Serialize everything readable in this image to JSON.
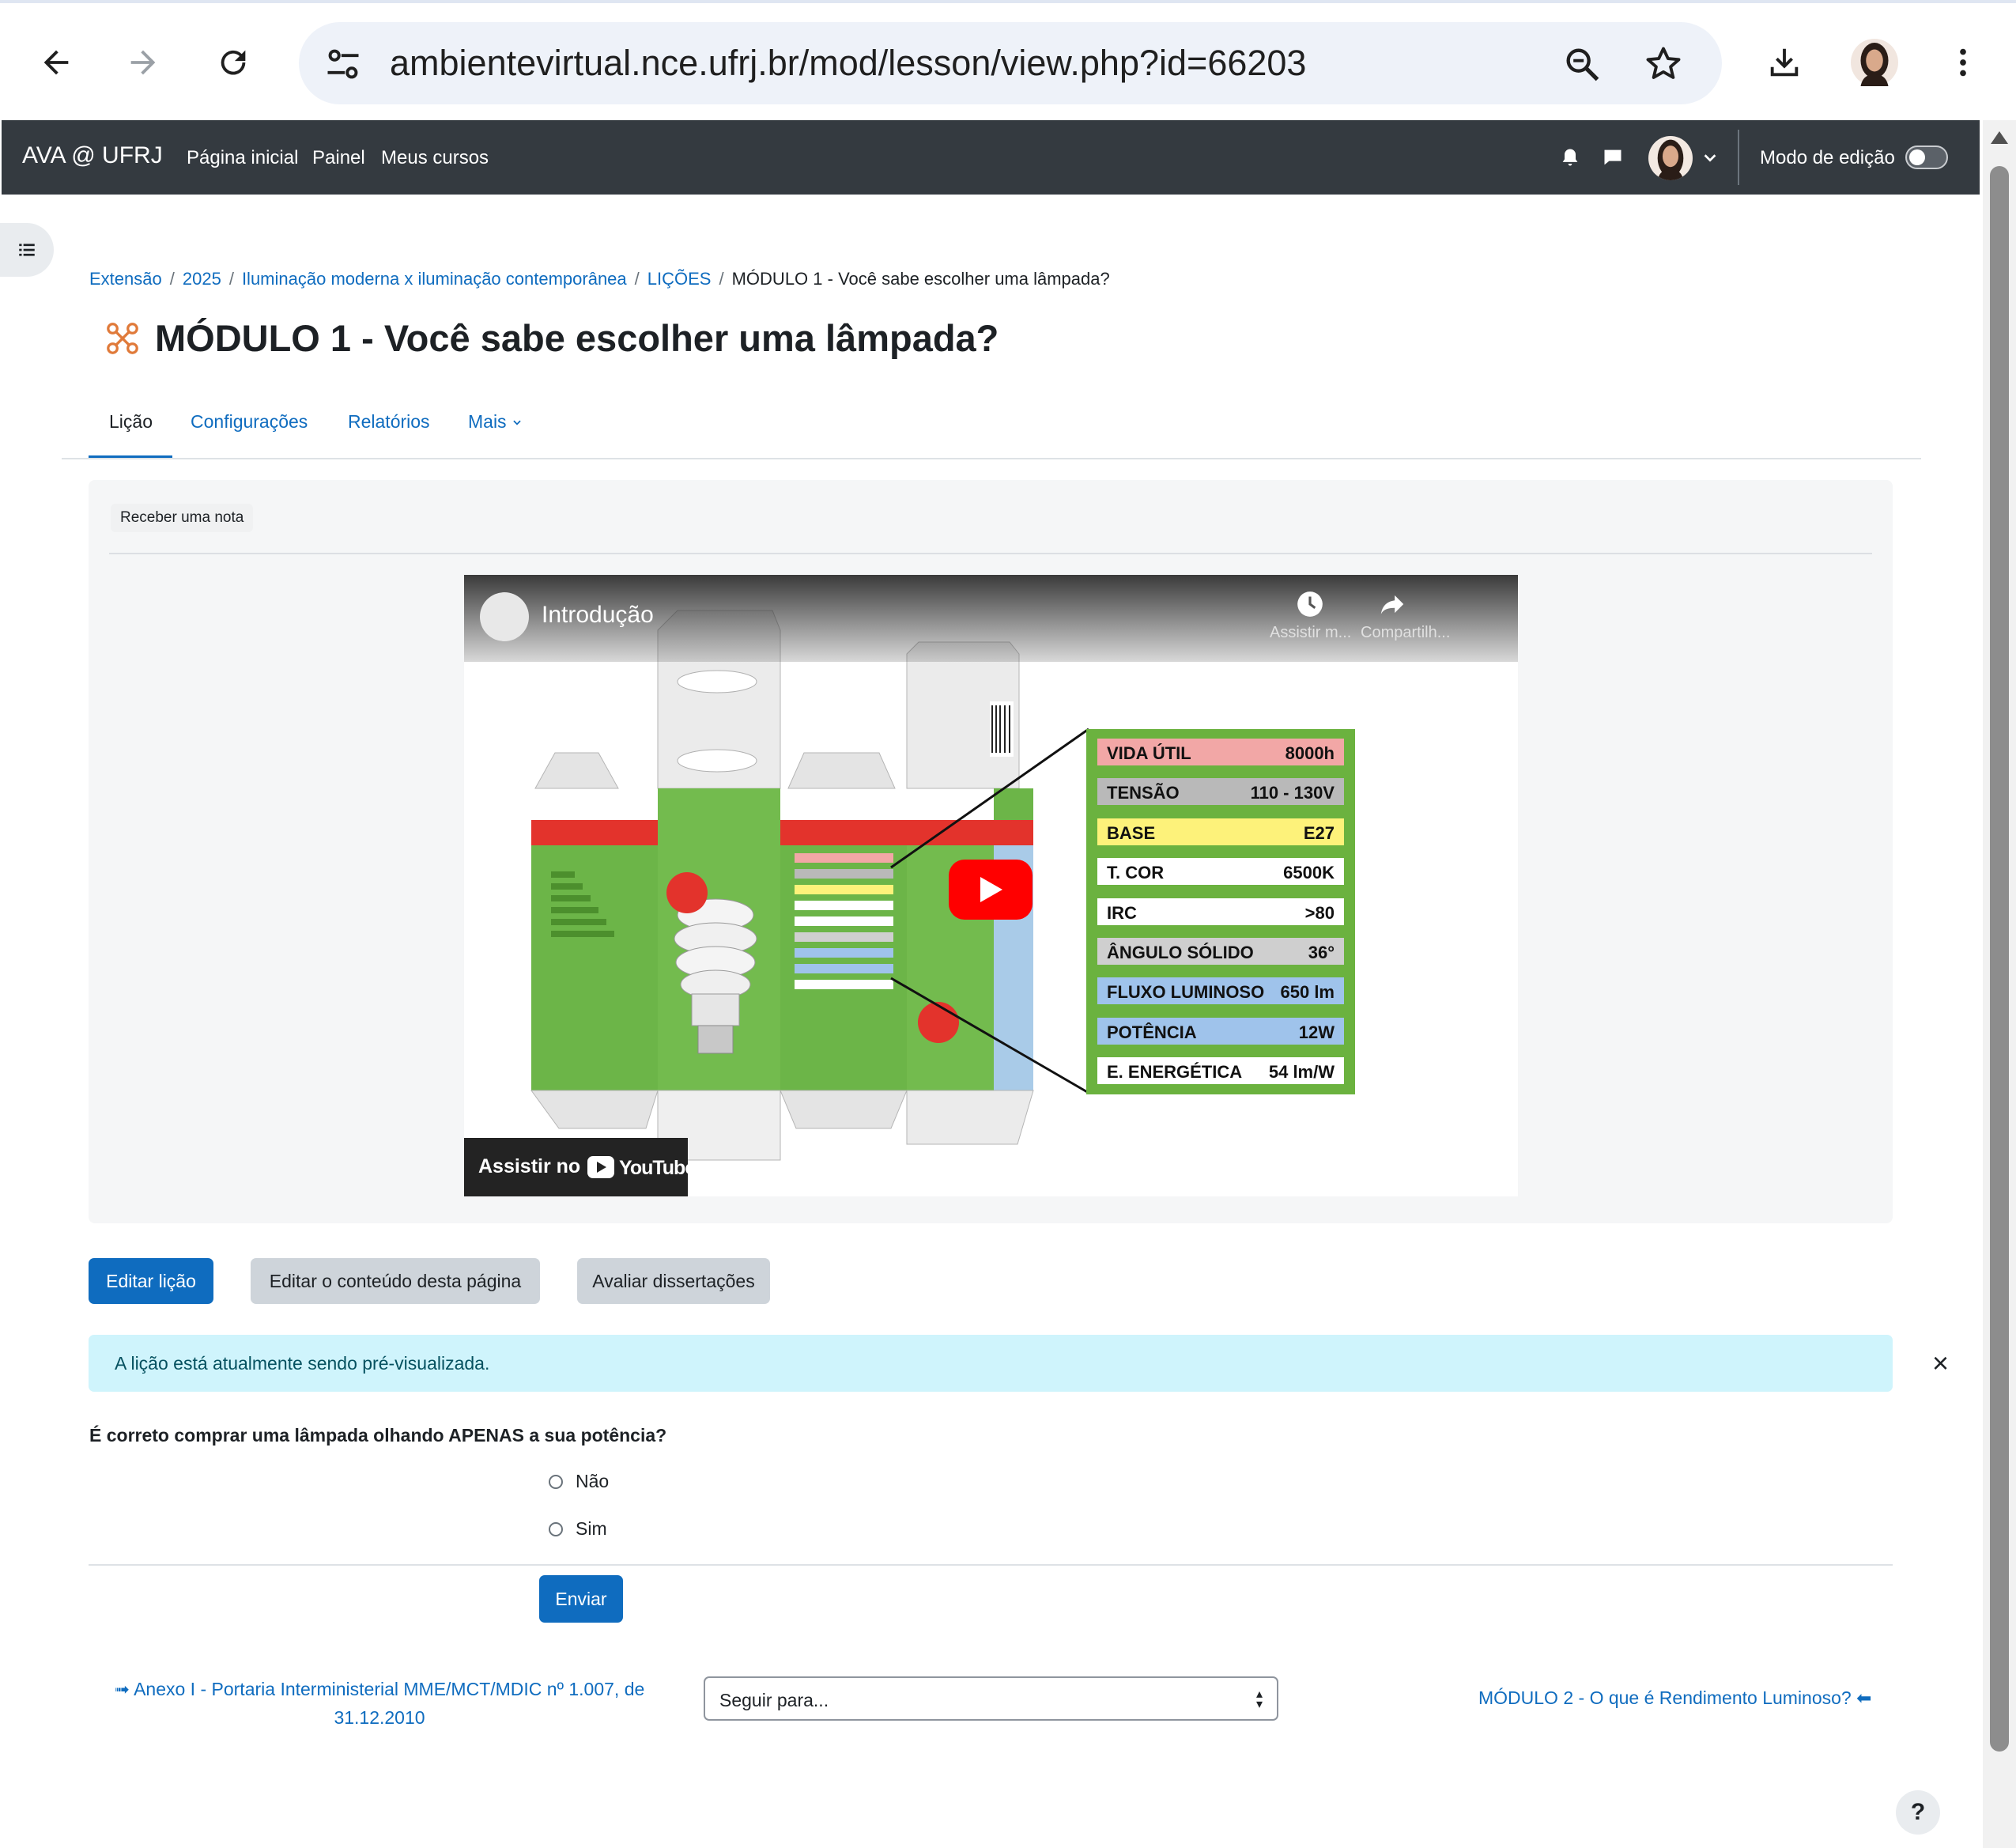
{
  "browser": {
    "url": "ambientevirtual.nce.ufrj.br/mod/lesson/view.php?id=66203",
    "icons": [
      "back-arrow-icon",
      "forward-arrow-icon",
      "reload-icon",
      "site-settings-icon",
      "zoom-icon",
      "bookmark-star-icon",
      "download-icon",
      "profile-avatar",
      "kebab-menu-icon"
    ]
  },
  "navbar": {
    "brand": "AVA @ UFRJ",
    "links": [
      "Página inicial",
      "Painel",
      "Meus cursos"
    ],
    "edit_mode_label": "Modo de edição"
  },
  "breadcrumb": {
    "items": [
      "Extensão",
      "2025",
      "Iluminação moderna x iluminação contemporânea",
      "LIÇÕES"
    ],
    "current": "MÓDULO 1 - Você sabe escolher uma lâmpada?"
  },
  "page_title": "MÓDULO 1 - Você sabe escolher uma lâmpada?",
  "tabs": [
    "Lição",
    "Configurações",
    "Relatórios",
    "Mais"
  ],
  "lesson": {
    "grade_badge": "Receber uma nota",
    "video": {
      "title": "Introdução",
      "watch_later": "Assistir m...",
      "share": "Compartilh...",
      "watch_on": "Assistir no",
      "platform": "YouTube",
      "spec_table": [
        {
          "label": "VIDA ÚTIL",
          "value": "8000h",
          "color": "#f2a7a6"
        },
        {
          "label": "TENSÃO",
          "value": "110 - 130V",
          "color": "#b9b9b9"
        },
        {
          "label": "BASE",
          "value": "E27",
          "color": "#fdf27a"
        },
        {
          "label": "T. COR",
          "value": "6500K",
          "color": "#ffffff"
        },
        {
          "label": "IRC",
          "value": ">80",
          "color": "#ffffff"
        },
        {
          "label": "ÂNGULO SÓLIDO",
          "value": "36°",
          "color": "#cfcfcf"
        },
        {
          "label": "FLUXO LUMINOSO",
          "value": "650 lm",
          "color": "#9fc3eb"
        },
        {
          "label": "POTÊNCIA",
          "value": "12W",
          "color": "#9fc3eb"
        },
        {
          "label": "E. ENERGÉTICA",
          "value": "54 lm/W",
          "color": "#ffffff"
        }
      ]
    }
  },
  "buttons": {
    "edit_lesson": "Editar lição",
    "edit_page": "Editar o conteúdo desta página",
    "assess": "Avaliar dissertações"
  },
  "alert": {
    "text": "A lição está atualmente sendo pré-visualizada.",
    "close": "×"
  },
  "question": {
    "text": "É correto comprar uma lâmpada olhando APENAS a sua potência?",
    "options": [
      "Não",
      "Sim"
    ],
    "submit": "Enviar"
  },
  "footer_nav": {
    "prev": "➟ Anexo I - Portaria Interministerial MME/MCT/MDIC nº 1.007, de 31.12.2010",
    "jump_placeholder": "Seguir para...",
    "next": "MÓDULO 2 - O que é Rendimento Luminoso? ⬅"
  },
  "help": "?"
}
